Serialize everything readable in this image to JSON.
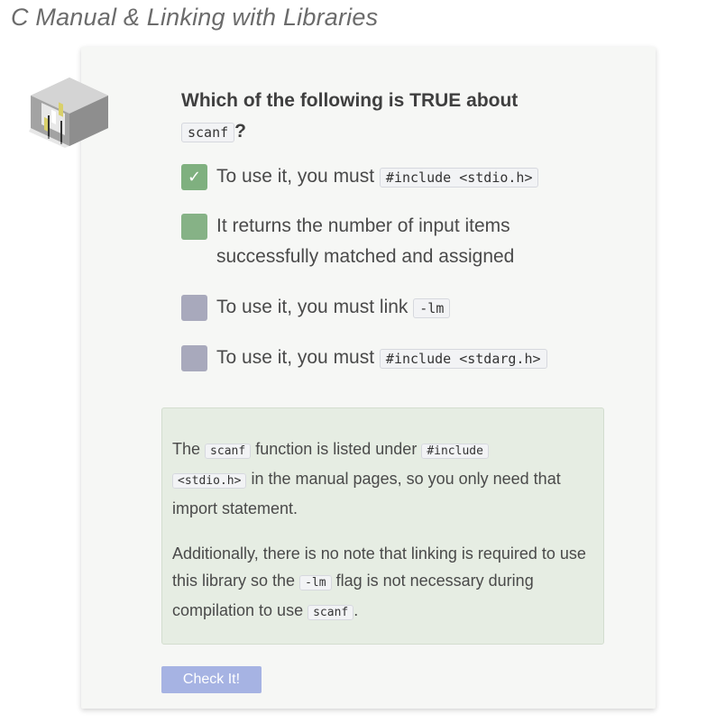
{
  "page": {
    "title": "C Manual & Linking with Libraries"
  },
  "question": {
    "text": "Which of the following is TRUE about",
    "code": "scanf",
    "suffix": "?"
  },
  "options": [
    {
      "text": "To use it, you must",
      "code": "#include <stdio.h>",
      "checked": true,
      "color": "#7fb07f"
    },
    {
      "text": "It returns the number of input items",
      "text2": "successfully matched and assigned",
      "checked": false,
      "color": "#86b286"
    },
    {
      "text": "To use it, you must link",
      "code": "-lm",
      "checked": false,
      "color": "#a8a9bc"
    },
    {
      "text": "To use it, you must",
      "code": "#include <stdarg.h>",
      "checked": false,
      "color": "#a8a9bc"
    }
  ],
  "feedback": {
    "p1": {
      "t1": "The",
      "c1": "scanf",
      "t2": "function is listed under",
      "c2a": "#include",
      "c2b": "<stdio.h>",
      "t3": "in the manual pages, so you only need that import statement."
    },
    "p2": {
      "t1": "Additionally, there is no note that linking is required to use this library so the",
      "c1": "-lm",
      "t2": "flag is not necessary during compilation to use",
      "c2": "scanf",
      "t3": "."
    }
  },
  "check_button": {
    "label": "Check It!",
    "color": "#a6b3e3"
  },
  "icons": {
    "question_icon": "gate-cube-icon",
    "check_mark": "checkmark-icon"
  }
}
